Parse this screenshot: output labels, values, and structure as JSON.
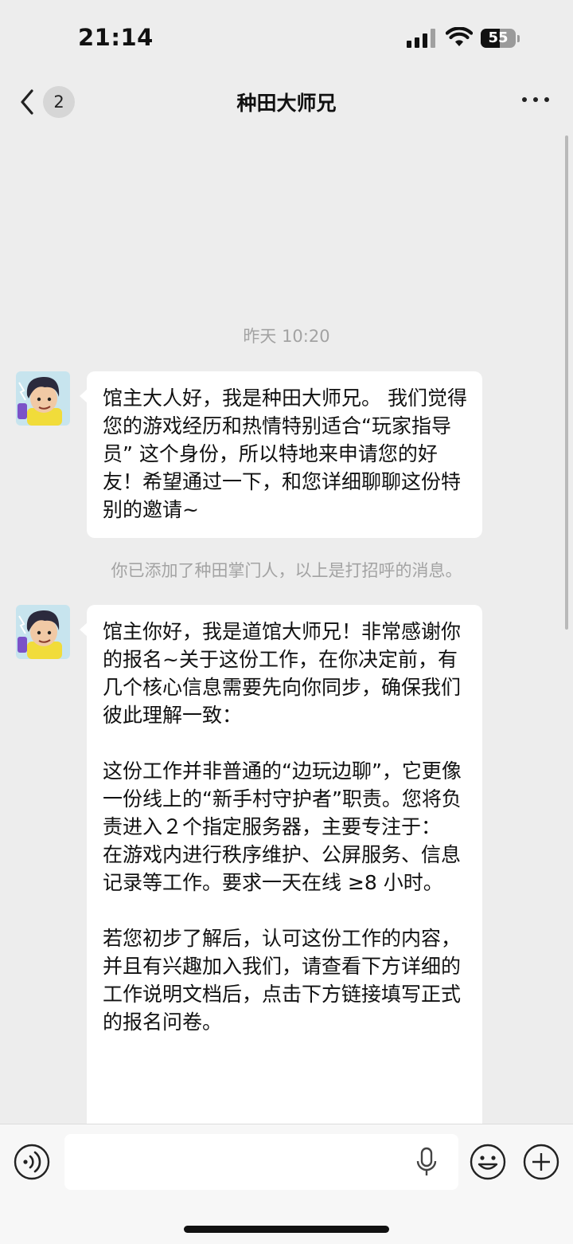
{
  "status_bar": {
    "time": "21:14",
    "battery_level": "55",
    "icons": [
      "signal-icon",
      "wifi-icon",
      "battery-icon"
    ]
  },
  "nav": {
    "unread_count": "2",
    "title": "种田大师兄",
    "icons": [
      "back-chevron-icon",
      "more-icon"
    ]
  },
  "chat": {
    "timestamp": "昨天 10:20",
    "messages": [
      {
        "sender": "种田大师兄",
        "paragraphs": [
          "馆主大人好，我是种田大师兄。 我们觉得您的游戏经历和热情特别适合“玩家指导员” 这个身份，所以特地来申请您的好友！希望通过一下，和您详细聊聊这份特别的邀请~"
        ]
      },
      {
        "sender": "种田大师兄",
        "paragraphs": [
          "馆主你好，我是道馆大师兄！非常感谢你的报名~关于这份工作，在你决定前，有几个核心信息需要先向你同步，确保我们彼此理解一致：",
          "这份工作并非普通的“边玩边聊”，它更像一份线上的“新手村守护者”职责。您将负责进入２个指定服务器，主要专注于：",
          "在游戏内进行秩序维护、公屏服务、信息记录等工作。要求一天在线 ≥8 小时。",
          "若您初步了解后，认可这份工作的内容，并且有兴趣加入我们，请查看下方详细的工作说明文档后，点击下方链接填写正式的报名问卷。"
        ]
      }
    ],
    "system_note": "你已添加了种田掌门人，以上是打招呼的消息。"
  },
  "input_bar": {
    "placeholder": "",
    "icons": [
      "voice-icon",
      "microphone-icon",
      "emoji-icon",
      "add-icon"
    ]
  },
  "colors": {
    "background": "#ededed",
    "bubble": "#ffffff",
    "muted_text": "#a3a3a3"
  }
}
